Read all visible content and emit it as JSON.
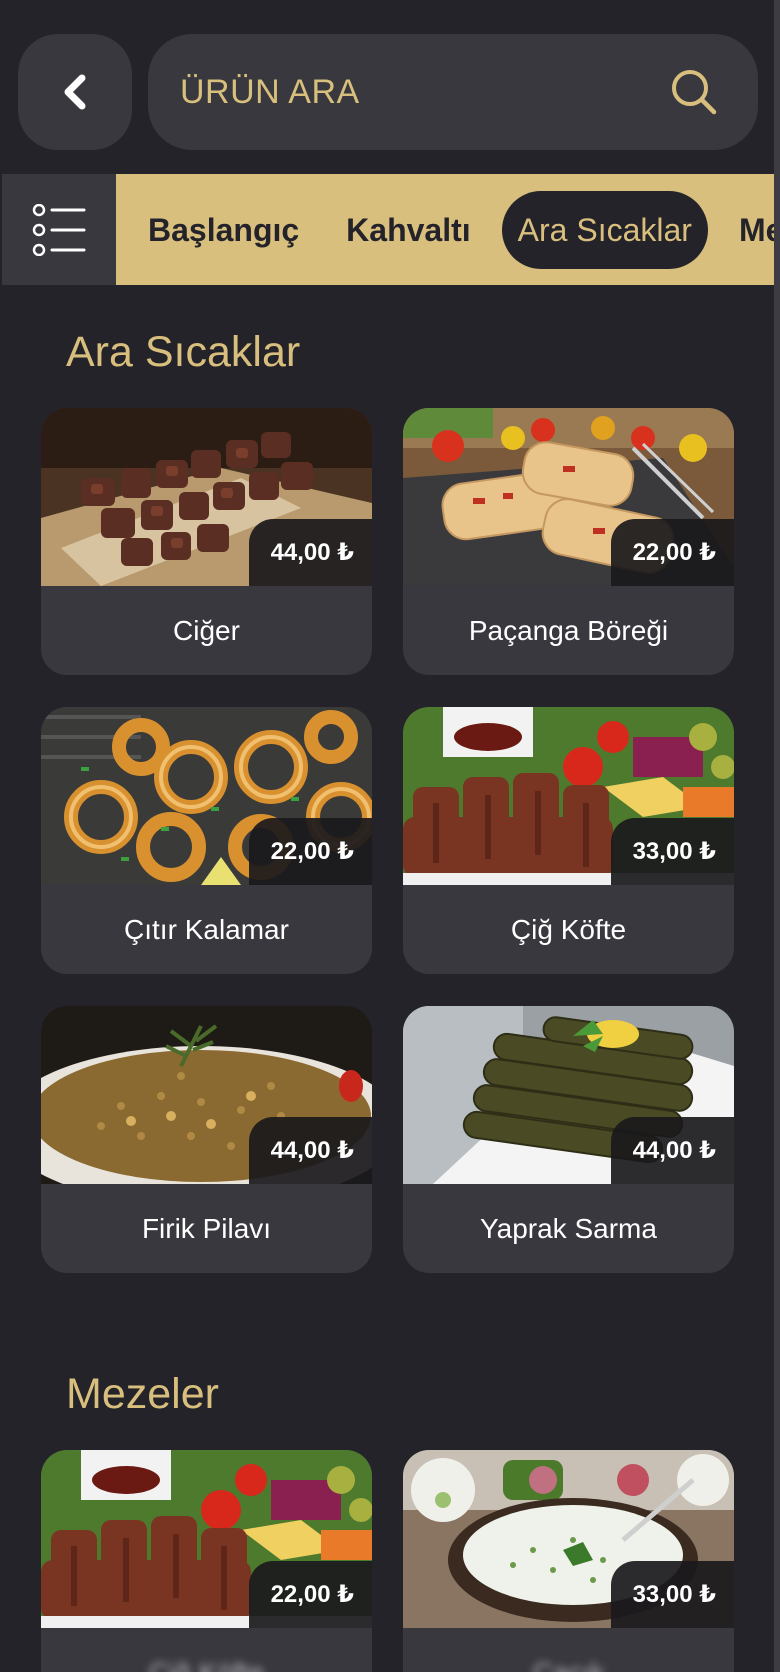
{
  "search": {
    "placeholder": "ÜRÜN ARA"
  },
  "categories": [
    "Başlangıç",
    "Kahvaltı",
    "Ara Sıcaklar",
    "Mezeler"
  ],
  "active_category": "Ara Sıcaklar",
  "sections": [
    {
      "title": "Ara Sıcaklar",
      "items": [
        {
          "name": "Ciğer",
          "price": "44,00 ₺",
          "icon": "liver-skewer-image"
        },
        {
          "name": "Paçanga Böreği",
          "price": "22,00 ₺",
          "icon": "borek-image"
        },
        {
          "name": "Çıtır Kalamar",
          "price": "22,00 ₺",
          "icon": "calamari-image"
        },
        {
          "name": "Çiğ Köfte",
          "price": "33,00 ₺",
          "icon": "cig-kofte-image"
        },
        {
          "name": "Firik Pilavı",
          "price": "44,00 ₺",
          "icon": "pilaf-image"
        },
        {
          "name": "Yaprak Sarma",
          "price": "44,00 ₺",
          "icon": "sarma-image"
        }
      ]
    },
    {
      "title": "Mezeler",
      "items": [
        {
          "name": "Çiğ Köfte",
          "price": "22,00 ₺",
          "icon": "cig-kofte-image"
        },
        {
          "name": "Cacık",
          "price": "33,00 ₺",
          "icon": "cacik-image"
        }
      ]
    }
  ],
  "colors": {
    "background": "#24232a",
    "accent": "#d9bf7d",
    "card": "#39383f"
  }
}
